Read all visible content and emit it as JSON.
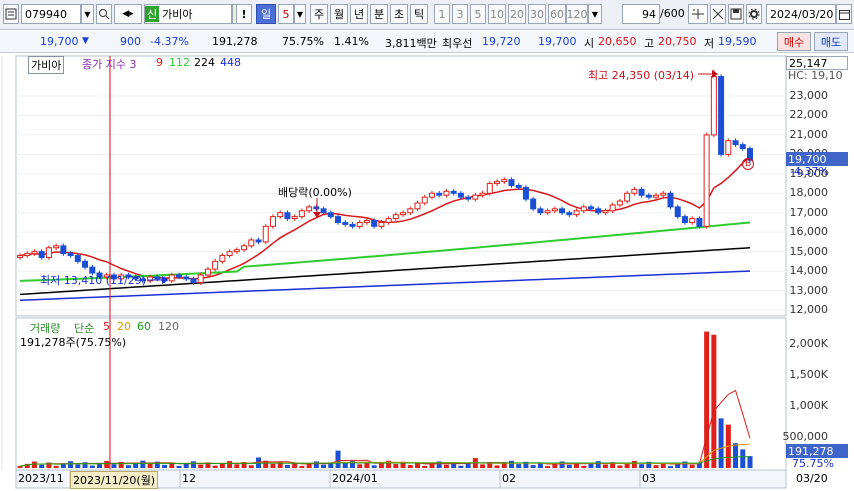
{
  "toolbar": {
    "code": "079940",
    "market_badge": "신",
    "name": "가비아",
    "alert_label": "!",
    "period_label": "일",
    "period_n": "5",
    "periods": [
      "주",
      "월",
      "년",
      "분",
      "초",
      "틱"
    ],
    "intervals": [
      "1",
      "3",
      "5",
      "10",
      "20",
      "30",
      "60",
      "120"
    ],
    "count": "94",
    "count_total": "/600",
    "date": "2024/03/20"
  },
  "quote": {
    "price": "19,700",
    "change": "900",
    "change_pct": "-4.37%",
    "volume": "191,278",
    "vol_ratio": "75.75%",
    "turnover_pct": "1.41%",
    "amount": "3,811백만",
    "best_bid_label": "최우선",
    "best_ask": "19,720",
    "best_bid": "19,700",
    "open_label": "시",
    "open": "20,650",
    "high_label": "고",
    "high": "20,750",
    "low_label": "저",
    "low": "19,590",
    "buy_label": "매수",
    "sell_label": "매도"
  },
  "price_panel": {
    "name_tag": "가비아",
    "indicator": "종가 지수 3",
    "ma_periods": [
      "9",
      "112",
      "224",
      "448"
    ],
    "ma_colors": [
      "#d6161b",
      "#2ecc2e",
      "#000000",
      "#1a2fd6"
    ],
    "y_top_label": "25,147",
    "y_hc": "HC: 19,10",
    "y_ticks": [
      "23,000",
      "22,000",
      "21,000",
      "20,000",
      "19,000",
      "18,000",
      "17,000",
      "16,000",
      "15,000",
      "14,000",
      "13,000",
      "12,000"
    ],
    "cur_price": "19,700",
    "cur_pct": "-4.37%",
    "high_annot": "최고 24,350 (03/14)",
    "low_annot": "최저 13,410 (11/29)",
    "div_annot": "배당락(0.00%)",
    "b_marker": "B"
  },
  "volume_panel": {
    "title": "거래량",
    "ma_label": "단순",
    "ma_periods": [
      "5",
      "20",
      "60",
      "120"
    ],
    "ma_colors": [
      "#d62020",
      "#e09a00",
      "#1a9a1a",
      "#666666"
    ],
    "info": "191,278주(75.75%)",
    "y_ticks": [
      "2,000K",
      "1,500K",
      "1,000K",
      "500,000"
    ],
    "cur_vol": "191,278",
    "cur_pct": "75.75%"
  },
  "x_axis": {
    "labels": [
      "2023/11",
      "2023/11/20(월)",
      "12",
      "2024/01",
      "02",
      "03",
      "03/20"
    ]
  },
  "colors": {
    "up": "#e0201a",
    "down": "#1a4fd6",
    "accent": "#4b6fd6"
  }
}
